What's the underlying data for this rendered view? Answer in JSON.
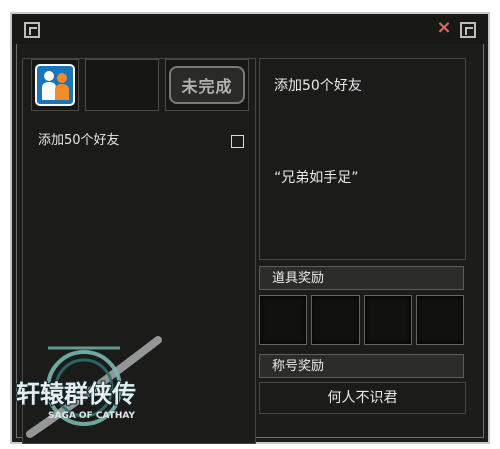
{
  "window": {
    "close_glyph": "×",
    "accent_color": "#d96b5e"
  },
  "left_panel": {
    "status_stamp": "未完成",
    "quest_item": "添加50个好友",
    "quest_completed": false
  },
  "right_panel": {
    "quest_title": "添加50个好友",
    "quest_quote": "“兄弟如手足”",
    "item_reward_label": "道具奖励",
    "title_reward_label": "称号奖励",
    "title_reward_value": "何人不识君"
  },
  "logo": {
    "title": "轩辕群侠传",
    "subtitle": "SAGA OF CATHAY"
  }
}
